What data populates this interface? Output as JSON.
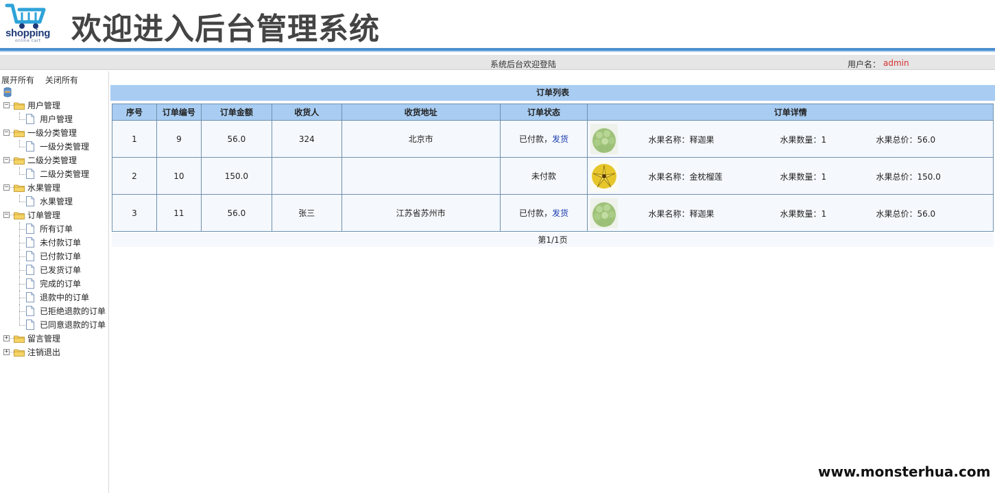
{
  "header": {
    "logo_text": "shopping",
    "logo_sub": "online cart",
    "title": "欢迎进入后台管理系统",
    "brand_color": "#4a8fd0"
  },
  "info_bar": {
    "welcome": "系统后台欢迎登陆",
    "user_label": "用户名：",
    "user_name": "admin"
  },
  "sidebar": {
    "expand_all": "展开所有",
    "collapse_all": "关闭所有",
    "groups": [
      {
        "label": "用户管理",
        "items": [
          "用户管理"
        ]
      },
      {
        "label": "一级分类管理",
        "items": [
          "一级分类管理"
        ]
      },
      {
        "label": "二级分类管理",
        "items": [
          "二级分类管理"
        ]
      },
      {
        "label": "水果管理",
        "items": [
          "水果管理"
        ]
      },
      {
        "label": "订单管理",
        "items": [
          "所有订单",
          "未付款订单",
          "已付款订单",
          "已发货订单",
          "完成的订单",
          "退款中的订单",
          "已拒绝退款的订单",
          "已同意退款的订单"
        ]
      },
      {
        "label": "留言管理",
        "items": []
      },
      {
        "label": "注销退出",
        "items": []
      }
    ]
  },
  "orders": {
    "title": "订单列表",
    "columns": [
      "序号",
      "订单编号",
      "订单金额",
      "收货人",
      "收货地址",
      "订单状态",
      "订单详情"
    ],
    "rows": [
      {
        "idx": "1",
        "order_no": "9",
        "amount": "56.0",
        "receiver": "324",
        "address": "北京市",
        "status": "已付款，",
        "action": "发货",
        "fruit": "green",
        "name": "水果名称：释迦果",
        "qty": "水果数量：1",
        "total": "水果总价：56.0"
      },
      {
        "idx": "2",
        "order_no": "10",
        "amount": "150.0",
        "receiver": "",
        "address": "",
        "status": "未付款",
        "action": "",
        "fruit": "yellow",
        "name": "水果名称：金枕榴莲",
        "qty": "水果数量：1",
        "total": "水果总价：150.0"
      },
      {
        "idx": "3",
        "order_no": "11",
        "amount": "56.0",
        "receiver": "张三",
        "address": "江苏省苏州市",
        "status": "已付款，",
        "action": "发货",
        "fruit": "green",
        "name": "水果名称：释迦果",
        "qty": "水果数量：1",
        "total": "水果总价：56.0"
      }
    ],
    "pager": "第1/1页"
  },
  "watermark": "www.monsterhua.com"
}
